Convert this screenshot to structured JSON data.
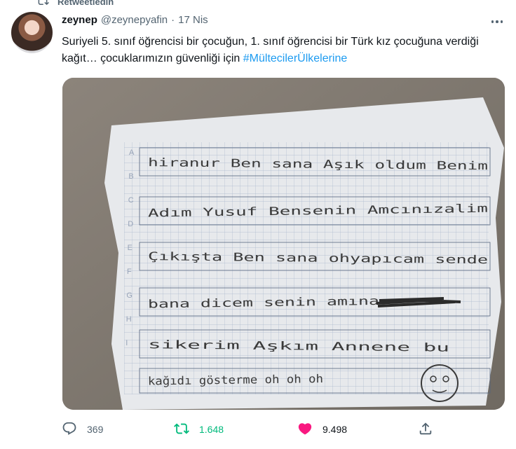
{
  "retweet_context": {
    "label": "Retweetledin"
  },
  "tweet": {
    "author_name": "zeynep",
    "handle": "@zeynepyafin",
    "separator": "·",
    "date": "17 Nis",
    "text_parts": {
      "before": "Suriyeli 5. sınıf öğrencisi bir çocuğun, 1. sınıf öğrencisi bir Türk kız çocuğuna verdiği kağıt… çocuklarımızın güvenliği için ",
      "hashtag": "#MültecilerÜlkelerine"
    }
  },
  "media": {
    "letter_rows": [
      "A",
      "B",
      "C",
      "D",
      "E",
      "F",
      "G",
      "H",
      "I"
    ],
    "handwritten_lines": [
      "hiranur Ben sana Aşık oldum Benim",
      "Adım Yusuf Bensenin Amcınızalim",
      "Çıkışta Ben sana ohyapıcam sende",
      "bana dicem senin amına",
      "sikerim Aşkım Annene bu",
      "kağıdı gösterme oh oh oh"
    ]
  },
  "actions": {
    "reply_count": "369",
    "retweet_count": "1.648",
    "like_count": "9.498"
  },
  "colors": {
    "accent": "#1d9bf0",
    "retweet_active": "#00ba7c",
    "like_active": "#f91880",
    "secondary_text": "#536471"
  }
}
